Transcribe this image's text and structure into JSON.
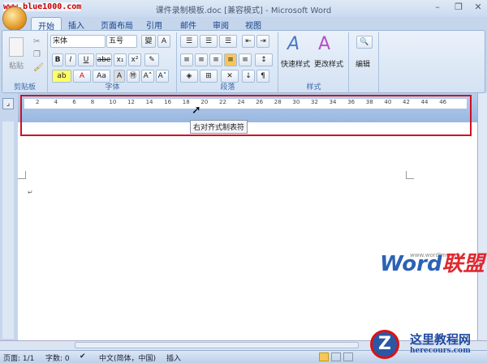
{
  "title_bar": {
    "title": "课件录制模板.doc [兼容模式] - Microsoft Word",
    "site": "www.blue1000.com",
    "minimize": "–",
    "restore": "❐",
    "close": "✕"
  },
  "tabs": [
    "开始",
    "插入",
    "页面布局",
    "引用",
    "邮件",
    "审阅",
    "视图"
  ],
  "ribbon": {
    "clipboard": {
      "label": "剪贴板",
      "paste": "粘贴"
    },
    "font": {
      "label": "字体",
      "font_name": "宋体",
      "font_size": "五号",
      "bold": "B",
      "italic": "I",
      "underline": "U",
      "strike": "abe",
      "sub": "x₁",
      "sup": "x²",
      "case": "Aa",
      "grow": "A˄",
      "shrink": "A˅"
    },
    "paragraph": {
      "label": "段落"
    },
    "styles": {
      "label": "样式",
      "quick": "快速样式",
      "change": "更改样式"
    },
    "editing": {
      "label": "编辑"
    }
  },
  "ruler": {
    "numbers": [
      "2",
      "4",
      "6",
      "8",
      "10",
      "12",
      "14",
      "16",
      "18",
      "20",
      "22",
      "24",
      "26",
      "28",
      "30",
      "32",
      "34",
      "36",
      "38",
      "40",
      "42",
      "44",
      "46"
    ]
  },
  "tooltip": "右对齐式制表符",
  "paragraph_mark": "↵",
  "status": {
    "page": "页面: 1/1",
    "words": "字数: 0",
    "language": "中文(简体，中国)",
    "mode": "插入"
  },
  "watermark": {
    "brand": "Word",
    "brand2": "联盟",
    "url": "www.wordlm.com"
  },
  "logo": {
    "letter": "Z",
    "name": "这里教程网",
    "url": "herecours.com"
  }
}
